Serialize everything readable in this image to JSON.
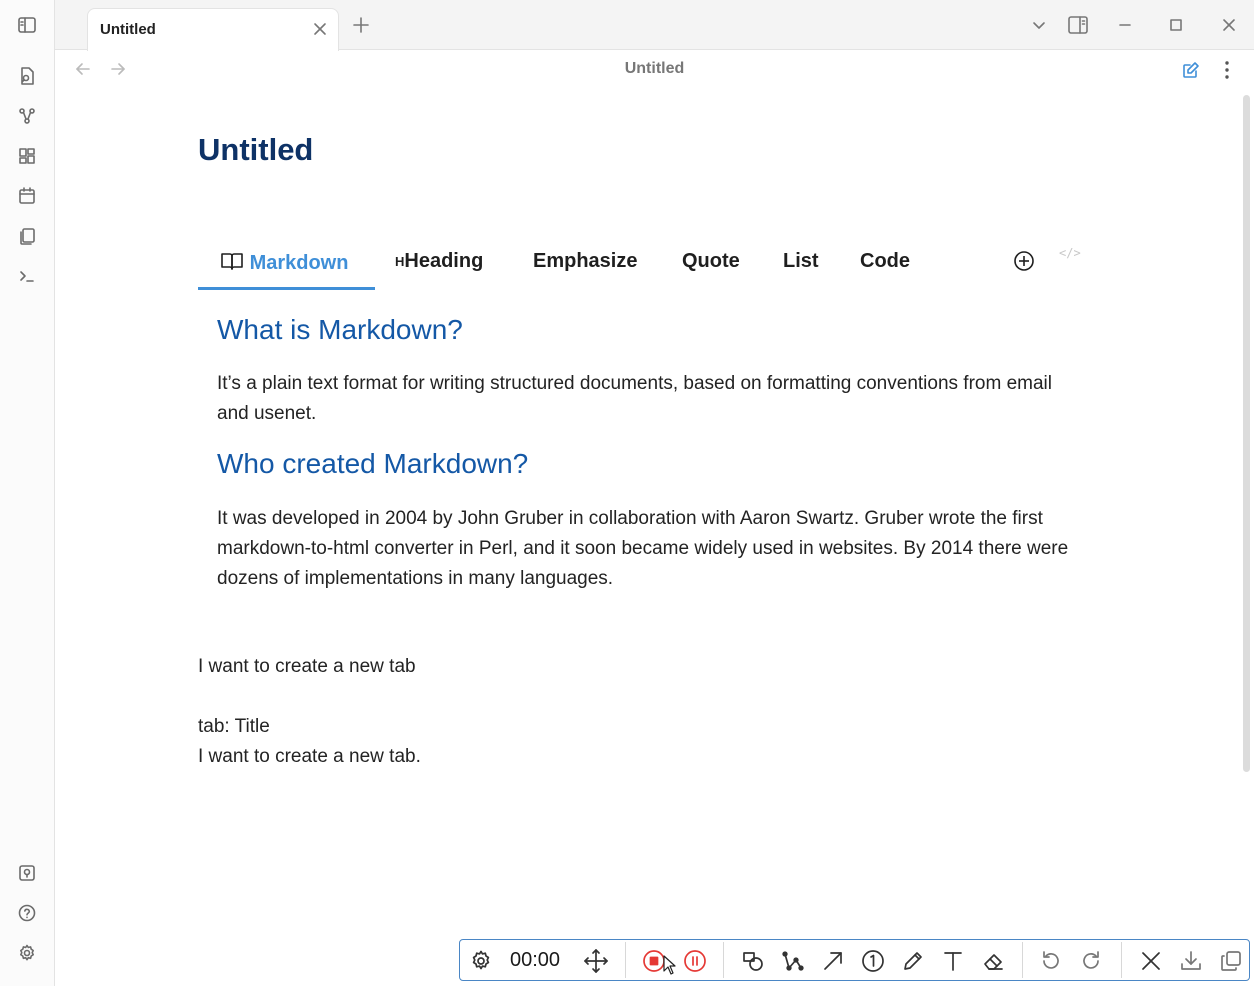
{
  "window": {
    "tab_title": "Untitled",
    "view_title": "Untitled"
  },
  "document": {
    "title": "Untitled",
    "tabs": [
      {
        "label": "Markdown",
        "icon": "book-open-icon",
        "active": true
      },
      {
        "label": "Heading",
        "prefix": "H",
        "active": false
      },
      {
        "label": "Emphasize",
        "active": false
      },
      {
        "label": "Quote",
        "active": false
      },
      {
        "label": "List",
        "active": false
      },
      {
        "label": "Code",
        "active": false
      }
    ],
    "code_toggle": "</>",
    "sections": [
      {
        "heading": "What is Markdown?",
        "text": "It’s a plain text format for writing structured documents, based on formatting conventions from email and usenet."
      },
      {
        "heading": "Who created Markdown?",
        "text": "It was developed in 2004 by John Gruber in collaboration with Aaron Swartz. Gruber wrote the first markdown-to-html converter in Perl, and it soon became widely used in websites. By 2014 there were dozens of implementations in many languages."
      }
    ],
    "lines": [
      "I want to create a new tab",
      "tab: Title",
      "I want to create a new tab."
    ]
  },
  "recorder": {
    "timer": "00:00"
  },
  "colors": {
    "accent": "#3f8fd8",
    "title": "#0e3266",
    "heading": "#1458a6",
    "record": "#e53935"
  }
}
